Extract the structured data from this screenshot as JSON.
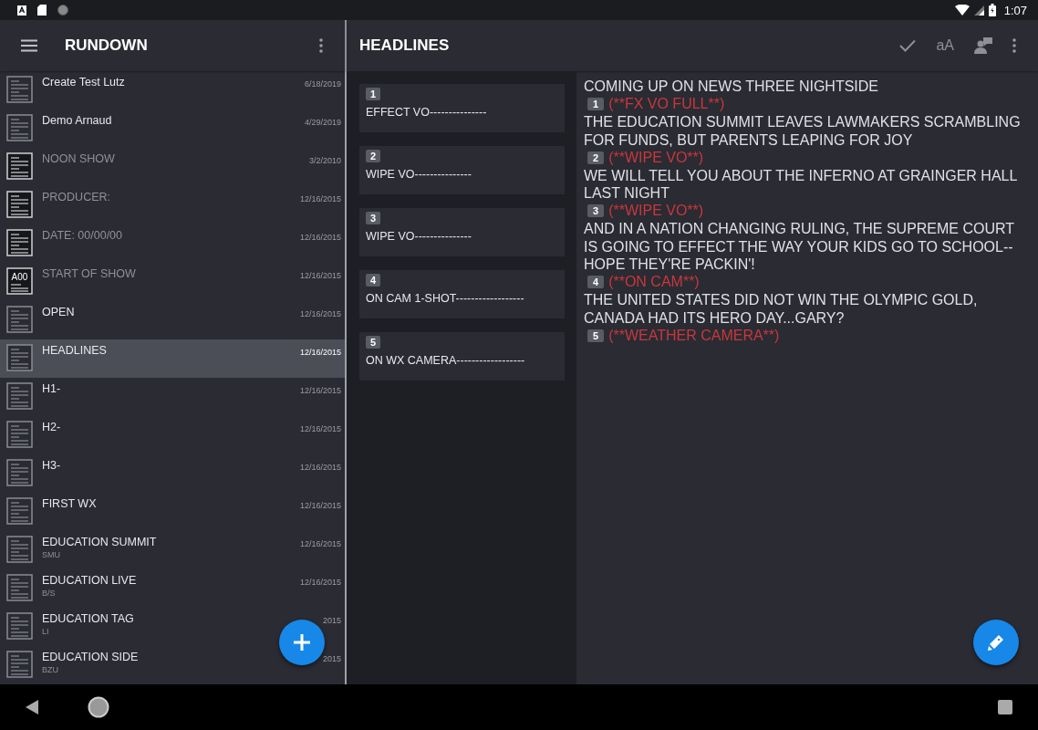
{
  "status_bar": {
    "time": "1:07"
  },
  "rundown": {
    "title": "RUNDOWN",
    "items": [
      {
        "kind": "story",
        "title": "Create Test Lutz",
        "date": "6/18/2019",
        "selected": false
      },
      {
        "kind": "story",
        "title": "Demo Arnaud",
        "date": "4/29/2019",
        "selected": false
      },
      {
        "kind": "break",
        "title": "NOON SHOW",
        "date": "3/2/2010",
        "selected": false
      },
      {
        "kind": "break",
        "title": "PRODUCER:",
        "date": "12/16/2015",
        "selected": false
      },
      {
        "kind": "break",
        "title": "DATE:   00/00/00",
        "date": "12/16/2015",
        "selected": false
      },
      {
        "kind": "segment",
        "icon_label": "A00",
        "title": "START OF SHOW",
        "date": "12/16/2015",
        "selected": false
      },
      {
        "kind": "story",
        "title": "OPEN",
        "date": "12/16/2015",
        "selected": false
      },
      {
        "kind": "story",
        "title": "HEADLINES",
        "date": "12/16/2015",
        "selected": true
      },
      {
        "kind": "story",
        "title": "H1-",
        "date": "12/16/2015",
        "selected": false
      },
      {
        "kind": "story",
        "title": "H2-",
        "date": "12/16/2015",
        "selected": false
      },
      {
        "kind": "story",
        "title": "H3-",
        "date": "12/16/2015",
        "selected": false
      },
      {
        "kind": "story",
        "title": "FIRST WX",
        "date": "12/16/2015",
        "selected": false
      },
      {
        "kind": "story",
        "title": "EDUCATION SUMMIT",
        "subtitle": "SMU",
        "date": "12/16/2015",
        "selected": false
      },
      {
        "kind": "story",
        "title": "EDUCATION LIVE",
        "subtitle": "B/S",
        "date": "12/16/2015",
        "selected": false
      },
      {
        "kind": "story",
        "title": "EDUCATION TAG",
        "subtitle": "LI",
        "date": "2015",
        "selected": false
      },
      {
        "kind": "story",
        "title": "EDUCATION SIDE",
        "subtitle": "BZU",
        "date": "2015",
        "selected": false
      }
    ]
  },
  "story": {
    "title": "HEADLINES",
    "cues": [
      {
        "number": "1",
        "text": "EFFECT VO---------------"
      },
      {
        "number": "2",
        "text": "WIPE VO---------------"
      },
      {
        "number": "3",
        "text": "WIPE VO---------------"
      },
      {
        "number": "4",
        "text": "ON CAM 1-SHOT------------------"
      },
      {
        "number": "5",
        "text": "ON WX CAMERA------------------"
      }
    ],
    "script": [
      {
        "kind": "text",
        "text": "COMING UP ON NEWS THREE NIGHTSIDE"
      },
      {
        "kind": "cue",
        "number": "1",
        "text": "(**FX VO FULL**)"
      },
      {
        "kind": "text",
        "text": "THE EDUCATION SUMMIT LEAVES LAWMAKERS SCRAMBLING FOR FUNDS, BUT PARENTS LEAPING FOR JOY"
      },
      {
        "kind": "cue",
        "number": "2",
        "text": "(**WIPE VO**)"
      },
      {
        "kind": "text",
        "text": "WE WILL TELL YOU ABOUT THE INFERNO AT GRAINGER HALL LAST NIGHT"
      },
      {
        "kind": "cue",
        "number": "3",
        "text": "(**WIPE VO**)"
      },
      {
        "kind": "text",
        "text": "AND IN A NATION CHANGING RULING, THE SUPREME COURT IS GOING TO EFFECT THE WAY YOUR KIDS GO TO SCHOOL--HOPE THEY'RE PACKIN'!"
      },
      {
        "kind": "cue",
        "number": "4",
        "text": "(**ON CAM**)"
      },
      {
        "kind": "text",
        "text": "THE UNITED STATES DID NOT WIN THE OLYMPIC GOLD, CANADA HAD ITS HERO DAY...GARY?"
      },
      {
        "kind": "cue",
        "number": "5",
        "text": "(**WEATHER CAMERA**)"
      }
    ],
    "font_button": "aA"
  }
}
